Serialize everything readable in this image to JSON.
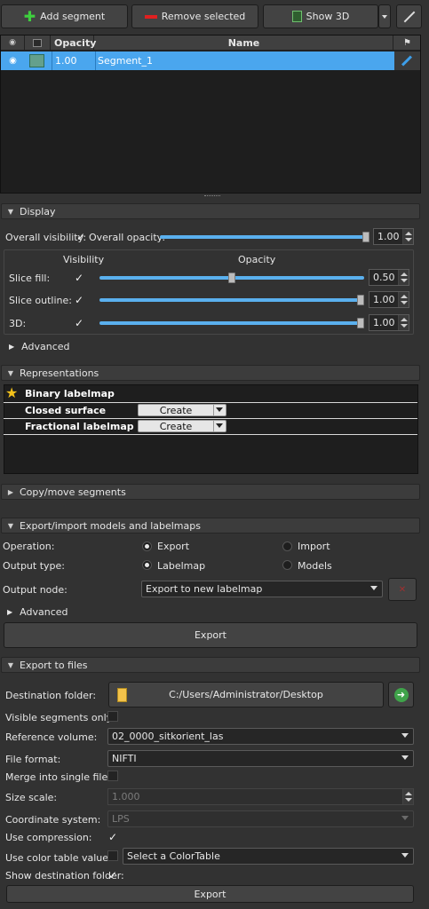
{
  "toolbar": {
    "add": "Add segment",
    "remove": "Remove selected",
    "show3d": "Show 3D"
  },
  "table": {
    "headers": {
      "opacity": "Opacity",
      "name": "Name"
    },
    "rows": [
      {
        "opacity": "1.00",
        "name": "Segment_1",
        "color": "#64a08c"
      }
    ]
  },
  "display": {
    "title": "Display",
    "overall_visibility": "Overall visibility:",
    "overall_opacity": "Overall opacity:",
    "overall_opacity_value": "1.00",
    "overall_opacity_level": 1.0,
    "col_visibility": "Visibility",
    "col_opacity": "Opacity",
    "slice_fill": "Slice fill:",
    "slice_fill_value": "0.50",
    "slice_fill_level": 0.5,
    "slice_outline": "Slice outline:",
    "slice_outline_value": "1.00",
    "threed": "3D:",
    "threed_value": "1.00",
    "advanced": "Advanced"
  },
  "representations": {
    "title": "Representations",
    "items": [
      {
        "name": "Binary labelmap",
        "master": true
      },
      {
        "name": "Closed surface",
        "action": "Create"
      },
      {
        "name": "Fractional labelmap",
        "action": "Create"
      }
    ]
  },
  "copy_move": {
    "title": "Copy/move segments"
  },
  "export_import": {
    "title": "Export/import models and labelmaps",
    "operation": "Operation:",
    "op_export": "Export",
    "op_import": "Import",
    "output_type": "Output type:",
    "type_labelmap": "Labelmap",
    "type_models": "Models",
    "output_node": "Output node:",
    "output_node_value": "Export to new labelmap",
    "advanced": "Advanced",
    "export_button": "Export"
  },
  "export_files": {
    "title": "Export to files",
    "destination": "Destination folder:",
    "destination_value": "C:/Users/Administrator/Desktop",
    "visible_only": "Visible segments only:",
    "reference": "Reference volume:",
    "reference_value": "02_0000_sitkorient_las",
    "format": "File format:",
    "format_value": "NIFTI",
    "merge": "Merge into single file:",
    "size_scale": "Size scale:",
    "size_scale_value": "1.000",
    "coord": "Coordinate system:",
    "coord_value": "LPS",
    "compression": "Use compression:",
    "color_table": "Use color table values:",
    "color_table_value": "Select a ColorTable",
    "show_dest": "Show destination folder:",
    "export_button": "Export"
  },
  "colors": {
    "accent": "#3d9ee9",
    "selected_row": "#4aa6ee",
    "bg": "#323232"
  }
}
